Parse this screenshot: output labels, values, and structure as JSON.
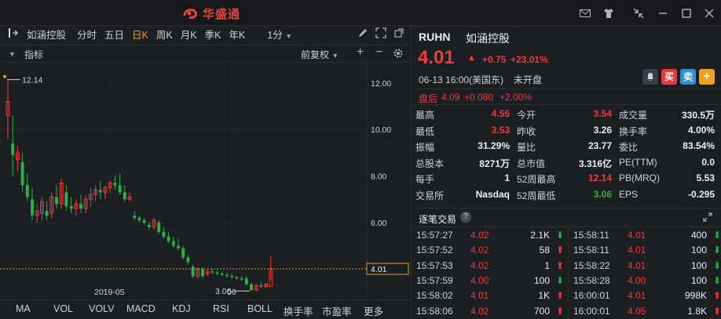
{
  "app": {
    "logo_text": "华盛通"
  },
  "toolbar": {
    "stock_name": "如涵控股",
    "periods": [
      "分时",
      "五日",
      "日K",
      "周K",
      "月K",
      "季K",
      "年K"
    ],
    "active_period": "日K",
    "interval": "1分"
  },
  "subbar": {
    "indicator_label": "指标",
    "adjust_label": "前复权"
  },
  "chart_data": {
    "type": "candlestick",
    "y_ticks": [
      "12.00",
      "10.00",
      "8.00",
      "6.00"
    ],
    "x_ticks": [
      "2019-05",
      "06"
    ],
    "high_label": "12.14",
    "low_label": "3.06",
    "current_price_label": "4.01",
    "current_price": 4.01,
    "ylim": [
      2.9,
      12.6
    ],
    "candles": [
      {
        "o": 10.6,
        "h": 12.14,
        "l": 9.6,
        "c": 11.2
      },
      {
        "o": 9.4,
        "h": 10.6,
        "l": 8.0,
        "c": 8.9
      },
      {
        "o": 8.7,
        "h": 9.3,
        "l": 8.2,
        "c": 9.0
      },
      {
        "o": 8.6,
        "h": 9.0,
        "l": 7.3,
        "c": 7.6
      },
      {
        "o": 7.6,
        "h": 8.1,
        "l": 6.9,
        "c": 7.1
      },
      {
        "o": 7.0,
        "h": 7.5,
        "l": 6.1,
        "c": 6.3
      },
      {
        "o": 6.3,
        "h": 6.8,
        "l": 6.0,
        "c": 6.5
      },
      {
        "o": 6.4,
        "h": 7.1,
        "l": 6.1,
        "c": 6.9
      },
      {
        "o": 6.5,
        "h": 6.9,
        "l": 6.1,
        "c": 6.3
      },
      {
        "o": 6.4,
        "h": 7.3,
        "l": 6.2,
        "c": 7.1
      },
      {
        "o": 7.1,
        "h": 7.6,
        "l": 6.6,
        "c": 6.8
      },
      {
        "o": 6.8,
        "h": 7.9,
        "l": 6.6,
        "c": 7.7
      },
      {
        "o": 7.3,
        "h": 7.6,
        "l": 6.5,
        "c": 6.7
      },
      {
        "o": 6.7,
        "h": 7.1,
        "l": 6.4,
        "c": 6.6
      },
      {
        "o": 6.6,
        "h": 7.0,
        "l": 6.3,
        "c": 6.8
      },
      {
        "o": 6.8,
        "h": 7.2,
        "l": 6.4,
        "c": 6.6
      },
      {
        "o": 6.6,
        "h": 7.2,
        "l": 6.4,
        "c": 7.0
      },
      {
        "o": 7.0,
        "h": 7.5,
        "l": 6.7,
        "c": 7.2
      },
      {
        "o": 7.2,
        "h": 7.6,
        "l": 6.9,
        "c": 7.4
      },
      {
        "o": 7.4,
        "h": 7.8,
        "l": 7.0,
        "c": 7.3
      },
      {
        "o": 7.3,
        "h": 7.6,
        "l": 7.0,
        "c": 7.5
      },
      {
        "o": 7.5,
        "h": 7.8,
        "l": 7.3,
        "c": 7.7
      },
      {
        "o": 7.7,
        "h": 8.0,
        "l": 7.4,
        "c": 7.6
      },
      {
        "o": 7.6,
        "h": 8.1,
        "l": 7.2,
        "c": 7.3
      },
      {
        "o": 7.3,
        "h": 7.6,
        "l": 6.9,
        "c": 7.0
      },
      {
        "o": 7.0,
        "h": 7.3,
        "l": 6.9,
        "c": 7.1
      },
      {
        "o": 6.3,
        "h": 6.5,
        "l": 6.1,
        "c": 6.2
      },
      {
        "o": 6.2,
        "h": 6.3,
        "l": 6.0,
        "c": 6.1
      },
      {
        "o": 6.1,
        "h": 6.2,
        "l": 5.9,
        "c": 6.0
      },
      {
        "o": 5.9,
        "h": 6.0,
        "l": 5.7,
        "c": 5.8
      },
      {
        "o": 5.8,
        "h": 6.2,
        "l": 5.7,
        "c": 6.1
      },
      {
        "o": 6.0,
        "h": 6.1,
        "l": 5.5,
        "c": 5.6
      },
      {
        "o": 5.6,
        "h": 5.8,
        "l": 5.3,
        "c": 5.4
      },
      {
        "o": 5.4,
        "h": 5.6,
        "l": 5.1,
        "c": 5.2
      },
      {
        "o": 5.2,
        "h": 5.4,
        "l": 4.9,
        "c": 5.0
      },
      {
        "o": 5.0,
        "h": 5.3,
        "l": 4.8,
        "c": 4.9
      },
      {
        "o": 4.9,
        "h": 5.0,
        "l": 4.4,
        "c": 4.5
      },
      {
        "o": 4.5,
        "h": 4.6,
        "l": 4.2,
        "c": 4.3
      },
      {
        "o": 4.1,
        "h": 4.2,
        "l": 3.6,
        "c": 3.7
      },
      {
        "o": 3.7,
        "h": 4.1,
        "l": 3.6,
        "c": 4.0
      },
      {
        "o": 4.0,
        "h": 4.1,
        "l": 3.6,
        "c": 3.7
      },
      {
        "o": 3.8,
        "h": 4.0,
        "l": 3.7,
        "c": 3.9
      },
      {
        "o": 3.9,
        "h": 4.0,
        "l": 3.8,
        "c": 3.85
      },
      {
        "o": 3.85,
        "h": 3.95,
        "l": 3.75,
        "c": 3.8
      },
      {
        "o": 3.8,
        "h": 3.9,
        "l": 3.7,
        "c": 3.75
      },
      {
        "o": 3.75,
        "h": 3.85,
        "l": 3.65,
        "c": 3.7
      },
      {
        "o": 3.7,
        "h": 3.8,
        "l": 3.6,
        "c": 3.65
      },
      {
        "o": 3.65,
        "h": 3.7,
        "l": 3.55,
        "c": 3.6
      },
      {
        "o": 3.6,
        "h": 3.7,
        "l": 3.5,
        "c": 3.55
      },
      {
        "o": 3.6,
        "h": 3.7,
        "l": 3.3,
        "c": 3.35
      },
      {
        "o": 3.35,
        "h": 3.4,
        "l": 3.06,
        "c": 3.1
      },
      {
        "o": 3.1,
        "h": 3.35,
        "l": 3.06,
        "c": 3.3
      },
      {
        "o": 3.3,
        "h": 3.45,
        "l": 3.2,
        "c": 3.25
      },
      {
        "o": 3.25,
        "h": 3.4,
        "l": 3.2,
        "c": 3.35
      },
      {
        "o": 3.26,
        "h": 4.55,
        "l": 3.53,
        "c": 4.01
      }
    ]
  },
  "tabs": [
    "MA",
    "VOL",
    "VOLV",
    "MACD",
    "KDJ",
    "RSI",
    "BOLL",
    "换手率",
    "市盈率",
    "更多"
  ],
  "quote": {
    "ticker": "RUHN",
    "name": "如涵控股",
    "price": "4.01",
    "change": "+0.75",
    "change_pct": "+23.01%",
    "datetime": "06-13 16:00(美国东)",
    "market_status": "未开盘",
    "after_label": "盘后",
    "after_price": "4.09",
    "after_change": "+0.080",
    "after_pct": "+2.00%",
    "buy_label": "买",
    "sell_label": "卖",
    "add_label": "+"
  },
  "stats": [
    [
      {
        "l": "最高",
        "v": "4.55",
        "c": "red"
      },
      {
        "l": "今开",
        "v": "3.54",
        "c": "red"
      },
      {
        "l": "成交量",
        "v": "330.5万",
        "c": "white"
      }
    ],
    [
      {
        "l": "最低",
        "v": "3.53",
        "c": "red"
      },
      {
        "l": "昨收",
        "v": "3.26",
        "c": "white"
      },
      {
        "l": "换手率",
        "v": "4.00%",
        "c": "white"
      }
    ],
    [
      {
        "l": "振幅",
        "v": "31.29%",
        "c": "white"
      },
      {
        "l": "量比",
        "v": "23.77",
        "c": "white"
      },
      {
        "l": "委比",
        "v": "83.54%",
        "c": "white"
      }
    ],
    [
      {
        "l": "总股本",
        "v": "8271万",
        "c": "white"
      },
      {
        "l": "总市值",
        "v": "3.316亿",
        "c": "white"
      },
      {
        "l": "PE(TTM)",
        "v": "0.0",
        "c": "white"
      }
    ],
    [
      {
        "l": "每手",
        "v": "1",
        "c": "white"
      },
      {
        "l": "52周最高",
        "v": "12.14",
        "c": "red"
      },
      {
        "l": "PB(MRQ)",
        "v": "5.53",
        "c": "white"
      }
    ],
    [
      {
        "l": "交易所",
        "v": "Nasdaq",
        "c": "white"
      },
      {
        "l": "52周最低",
        "v": "3.06",
        "c": "green"
      },
      {
        "l": "EPS",
        "v": "-0.295",
        "c": "white"
      }
    ]
  ],
  "trades_title": "逐笔交易",
  "trades_left": [
    {
      "t": "15:57:27",
      "p": "4.02",
      "v": "2.1K",
      "d": "down"
    },
    {
      "t": "15:57:52",
      "p": "4.02",
      "v": "58",
      "d": "up"
    },
    {
      "t": "15:57:53",
      "p": "4.02",
      "v": "1",
      "d": "up"
    },
    {
      "t": "15:57:59",
      "p": "4.00",
      "v": "100",
      "d": "down"
    },
    {
      "t": "15:58:02",
      "p": "4.01",
      "v": "1K",
      "d": "up"
    },
    {
      "t": "15:58:06",
      "p": "4.02",
      "v": "700",
      "d": "up"
    }
  ],
  "trades_right": [
    {
      "t": "15:58:11",
      "p": "4.01",
      "v": "400",
      "d": "down"
    },
    {
      "t": "15:58:11",
      "p": "4.01",
      "v": "100",
      "d": "down"
    },
    {
      "t": "15:58:22",
      "p": "4.01",
      "v": "100",
      "d": "down"
    },
    {
      "t": "15:58:28",
      "p": "4.00",
      "v": "100",
      "d": "down"
    },
    {
      "t": "16:00:01",
      "p": "4.01",
      "v": "998K",
      "d": "up"
    },
    {
      "t": "16:00:01",
      "p": "4.05",
      "v": "1.8K",
      "d": "up"
    }
  ],
  "colors": {
    "up": "#f23a3a",
    "down": "#2ab34a",
    "accent": "#f0a020",
    "bg": "#1b1e23"
  }
}
